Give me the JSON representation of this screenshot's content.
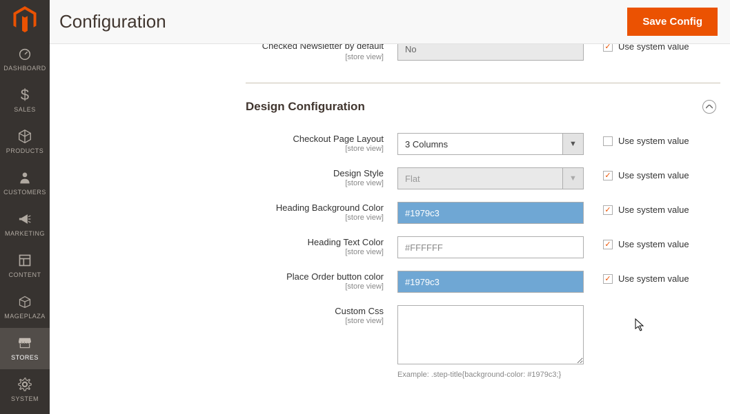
{
  "header": {
    "page_title": "Configuration",
    "save_label": "Save Config"
  },
  "sidebar": {
    "items": [
      {
        "label": "DASHBOARD",
        "icon": "dashboard-icon"
      },
      {
        "label": "SALES",
        "icon": "dollar-icon"
      },
      {
        "label": "PRODUCTS",
        "icon": "cube-icon"
      },
      {
        "label": "CUSTOMERS",
        "icon": "person-icon"
      },
      {
        "label": "MARKETING",
        "icon": "megaphone-icon"
      },
      {
        "label": "CONTENT",
        "icon": "layout-icon"
      },
      {
        "label": "MAGEPLAZA",
        "icon": "box-icon"
      },
      {
        "label": "STORES",
        "icon": "storefront-icon"
      },
      {
        "label": "SYSTEM",
        "icon": "gear-icon"
      }
    ]
  },
  "peek_row": {
    "label": "Checked Newsletter by default",
    "scope": "[store view]",
    "value": "No",
    "use_system_label": "Use system value",
    "checked": true
  },
  "section": {
    "title": "Design Configuration"
  },
  "fields": {
    "layout": {
      "label": "Checkout Page Layout",
      "scope": "[store view]",
      "value": "3 Columns",
      "use_system_label": "Use system value",
      "use_system_checked": false
    },
    "style": {
      "label": "Design Style",
      "scope": "[store view]",
      "value": "Flat",
      "use_system_label": "Use system value",
      "use_system_checked": true
    },
    "heading_bg": {
      "label": "Heading Background Color",
      "scope": "[store view]",
      "value": "#1979c3",
      "use_system_label": "Use system value",
      "use_system_checked": true
    },
    "heading_text": {
      "label": "Heading Text Color",
      "scope": "[store view]",
      "value": "#FFFFFF",
      "use_system_label": "Use system value",
      "use_system_checked": true
    },
    "place_order": {
      "label": "Place Order button color",
      "scope": "[store view]",
      "value": "#1979c3",
      "use_system_label": "Use system value",
      "use_system_checked": true
    },
    "custom_css": {
      "label": "Custom Css",
      "scope": "[store view]",
      "value": "",
      "hint": "Example: .step-title{background-color: #1979c3;}"
    }
  }
}
